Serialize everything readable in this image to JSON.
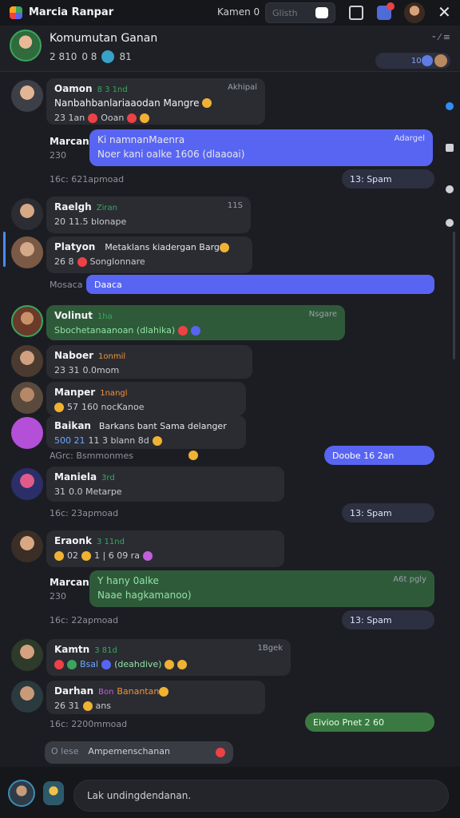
{
  "app": {
    "title": "Marcia Ranpar",
    "tab_label": "Kamen",
    "tab_count": "0"
  },
  "search": {
    "placeholder": "Glisth"
  },
  "channel": {
    "name": "Komumutan Ganan",
    "sub_left": "2 810",
    "sub_mid": "0 8",
    "sub_right": "81",
    "header_pill": "101"
  },
  "messages": [
    {
      "name": "Oamon",
      "tag": "8 3 1nd",
      "text": "Nanbahbanlariaaodan Mangre",
      "meta": "23 1an",
      "meta2": "Ooan",
      "time": "Akhipal"
    },
    {
      "name": "Marcan",
      "meta": "230",
      "bubble_title": "Ki namnanMaenra",
      "bubble_text": "Noer kani oalke 1606 (dlaaoai)",
      "time": "Adargel"
    },
    {
      "system": "16c: 621apmoad",
      "pill": "13:  Spam"
    },
    {
      "name": "Raelgh",
      "tag": "Ziran",
      "meta": "20",
      "text": "11.5 blonape",
      "time": "11S"
    },
    {
      "name": "Platyon",
      "text": "Metaklans kiadergan  Barg",
      "meta": "26 8",
      "text2": "Songlonnare"
    },
    {
      "name": "Mosaca",
      "pill": "Daaca"
    },
    {
      "name": "Volinut",
      "tag": "1ha",
      "text": "Sbochetanaanoan (dlahika)",
      "time": "Nsgare"
    },
    {
      "name": "Naboer",
      "tag": "1onmil",
      "meta": "23  31",
      "text": "0.0mom"
    },
    {
      "name": "Manper",
      "tag": "1nangl",
      "meta": "57",
      "text": "160 nocKanoe"
    },
    {
      "name": "Baikan",
      "text": "Barkans bant Sama delanger",
      "meta": "500 21",
      "text2": "11 3 blann 8d"
    },
    {
      "system": "AGrc: Bsmmonmes",
      "pill": "Doobe  16 2an"
    },
    {
      "name": "Maniela",
      "tag": "3rd",
      "meta": "31",
      "text": "0.0 Metarpe"
    },
    {
      "system": "16c: 23apmoad",
      "pill": "13:  Spam"
    },
    {
      "name": "Eraonk",
      "tag": "3 11nd",
      "meta": "02",
      "text": "1 | 6 09  ra"
    },
    {
      "name": "Marcan",
      "meta": "230",
      "bubble_title": "Y hany 0alke",
      "bubble_text": "Naae hagkamanoo)",
      "time": "A6t pgly"
    },
    {
      "system": "16c: 22apmoad",
      "pill": "13:  Spam"
    },
    {
      "name": "Kamtn",
      "tag": "3 81d",
      "text": "(deahdive)",
      "meta_tag": "Bsal",
      "time": "1Bgek"
    },
    {
      "name": "Darhan",
      "tag": "Bon",
      "text": "Banantan",
      "meta": "26  31",
      "text2": "ans"
    },
    {
      "system": "16c: 2200mmoad",
      "pill": "Eivioo Pnet  2  60"
    },
    {
      "system_typing": "O lese",
      "typing": "Ampemenschanan"
    }
  ],
  "composer": {
    "placeholder": "Lak undingdendanan."
  }
}
